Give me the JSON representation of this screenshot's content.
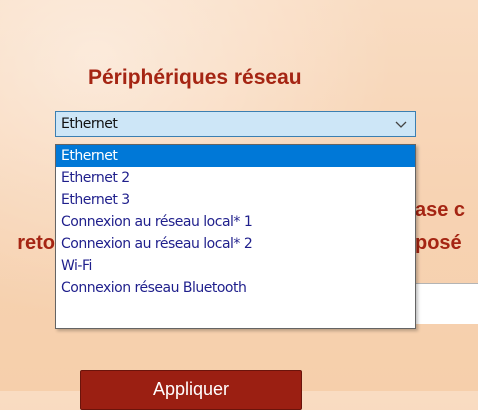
{
  "section": {
    "title": "Périphériques réseau"
  },
  "combo": {
    "selected_value": "Ethernet",
    "options": [
      "Ethernet",
      "Ethernet 2",
      "Ethernet 3",
      "Connexion au réseau local* 1",
      "Connexion au réseau local* 2",
      "Wi-Fi",
      "Connexion réseau Bluetooth"
    ],
    "highlighted_index": 0
  },
  "background_fragments": {
    "left": "reto",
    "right_1": "ase c",
    "right_2": "posé"
  },
  "bottom_button": {
    "label": "Appliquer"
  },
  "colors": {
    "title_red": "#a52513",
    "selection_blue": "#0078d7",
    "combo_bg": "#cde6f7",
    "button_red": "#9b1f12"
  }
}
